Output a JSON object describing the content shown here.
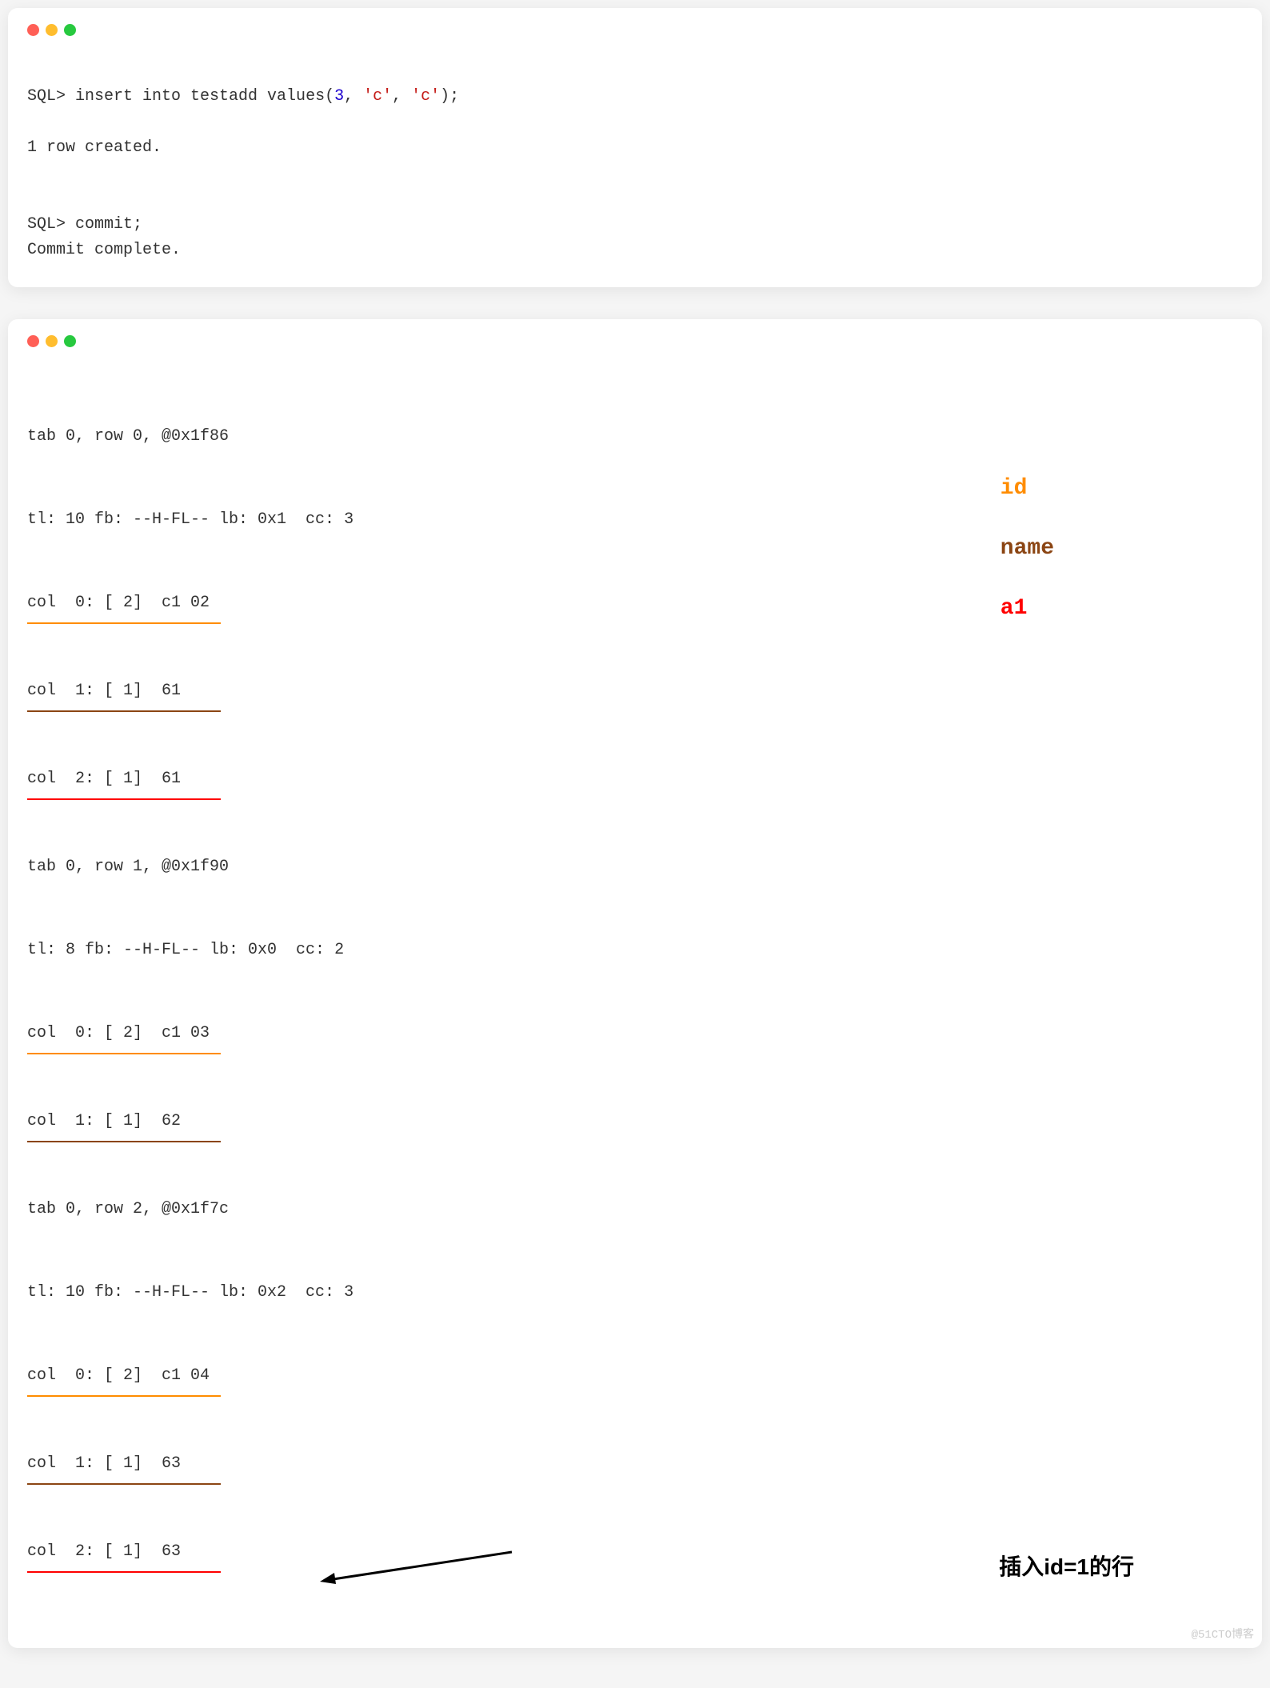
{
  "window1": {
    "line1_prefix": "SQL> ",
    "line1_cmd1": "insert into testadd values(",
    "line1_num": "3",
    "line1_sep1": ", ",
    "line1_str1": "'c'",
    "line1_sep2": ", ",
    "line1_str2": "'c'",
    "line1_close": ");",
    "line2": "1 row created.",
    "line3_prefix": "SQL> ",
    "line3_cmd": "commit;",
    "line4": "Commit complete."
  },
  "window2": {
    "row0_header": "tab 0, row 0, @0x1f86",
    "row0_tl": "tl: 10 fb: --H-FL-- lb: 0x1  cc: 3",
    "row0_col0": "col  0: [ 2]  c1 02",
    "row0_col1": "col  1: [ 1]  61",
    "row0_col2": "col  2: [ 1]  61",
    "row1_header": "tab 0, row 1, @0x1f90",
    "row1_tl": "tl: 8 fb: --H-FL-- lb: 0x0  cc: 2",
    "row1_col0": "col  0: [ 2]  c1 03",
    "row1_col1": "col  1: [ 1]  62",
    "row2_header": "tab 0, row 2, @0x1f7c",
    "row2_tl": "tl: 10 fb: --H-FL-- lb: 0x2  cc: 3",
    "row2_col0": "col  0: [ 2]  c1 04",
    "row2_col1": "col  1: [ 1]  63",
    "row2_col2": "col  2: [ 1]  63"
  },
  "annotations": {
    "id": "id",
    "name": "name",
    "a1": "a1",
    "arrow_text": "插入id=1的行"
  },
  "watermark": "@51CTO博客"
}
